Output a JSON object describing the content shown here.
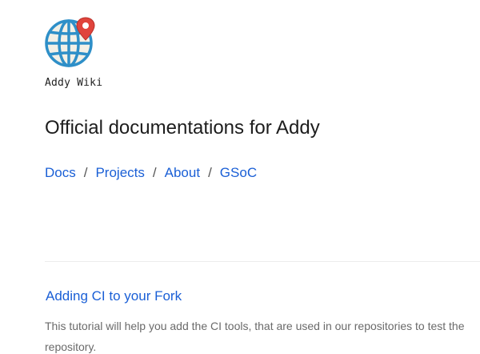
{
  "header": {
    "logo_icon": "globe-with-map-pin-icon",
    "site_name": "Addy Wiki",
    "tagline": "Official documentations for Addy"
  },
  "nav": {
    "items": [
      "Docs",
      "Projects",
      "About",
      "GSoC"
    ],
    "separator": "/"
  },
  "posts": [
    {
      "title": "Adding CI to your Fork",
      "excerpt_line_1": "This tutorial will help you add the CI tools, that are used in our repositories to test the",
      "excerpt_line_2": "repository."
    }
  ],
  "colors": {
    "link": "#1a5fd6",
    "text": "#1d1d1d",
    "muted": "#6a6a6a",
    "globe_blue": "#2e8fc8",
    "pin_red": "#e0443c"
  }
}
